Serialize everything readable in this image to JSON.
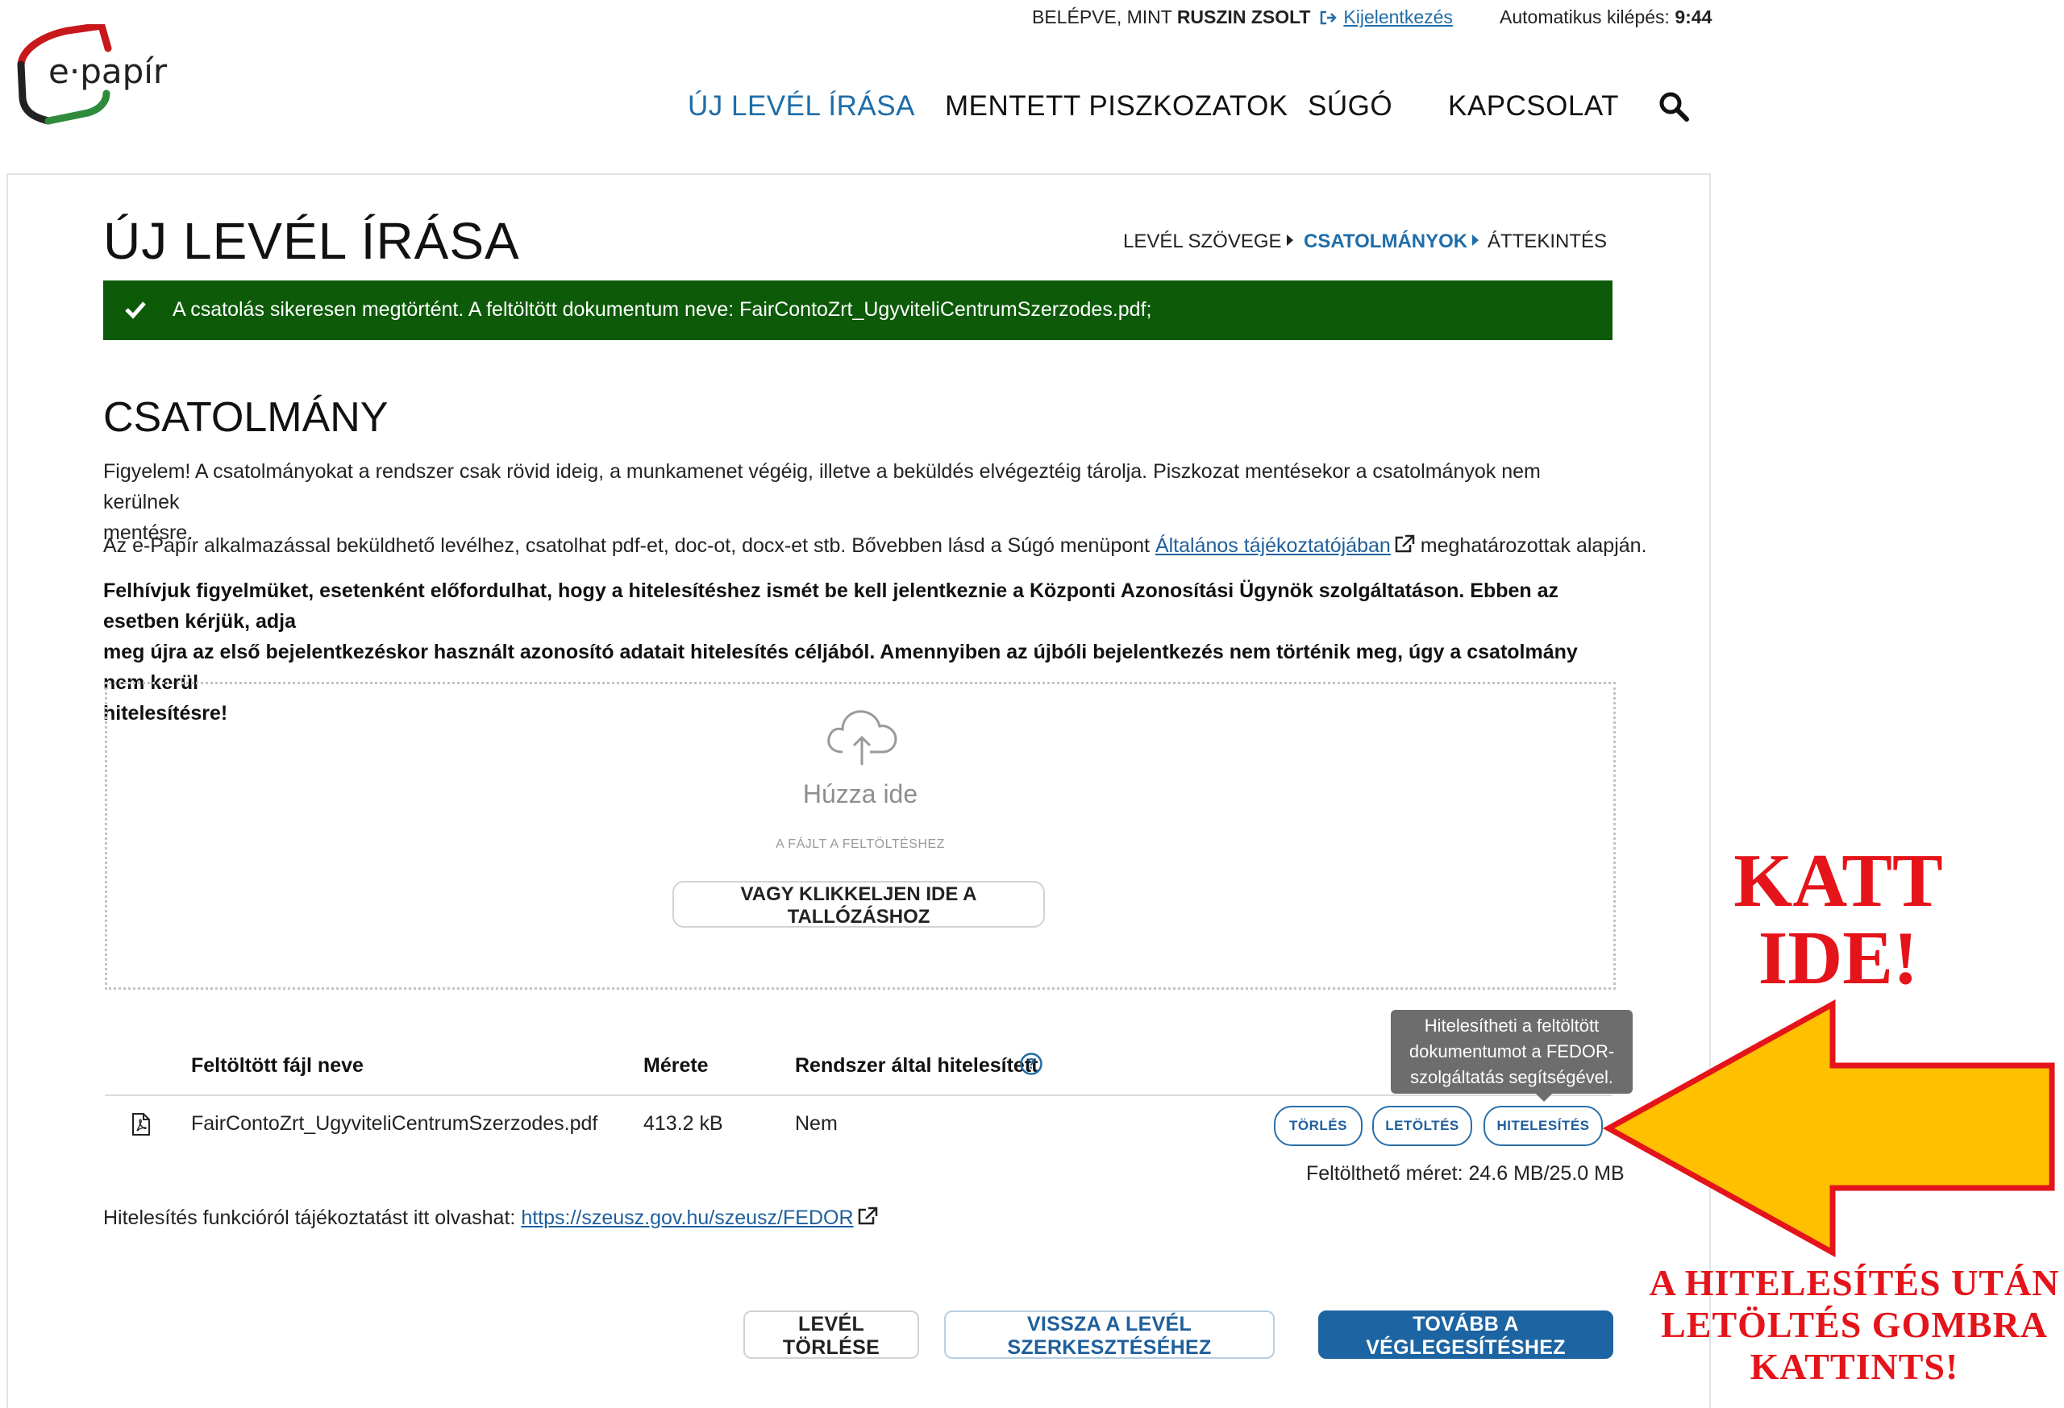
{
  "header": {
    "logged_in_prefix": "BELÉPVE, MINT",
    "user_name": "RUSZIN ZSOLT",
    "logout_label": "Kijelentkezés",
    "auto_logout_label": "Automatikus kilépés:",
    "auto_logout_time": "9:44",
    "logo_text": "e·papír",
    "nav": [
      "ÚJ LEVÉL ÍRÁSA",
      "MENTETT PISZKOZATOK",
      "SÚGÓ",
      "KAPCSOLAT"
    ],
    "search_icon": "search-icon"
  },
  "page": {
    "title": "ÚJ LEVÉL ÍRÁSA",
    "steps": [
      "LEVÉL SZÖVEGE",
      "CSATOLMÁNYOK",
      "ÁTTEKINTÉS"
    ],
    "active_step": "CSATOLMÁNYOK",
    "success_message": "A csatolás sikeresen megtörtént. A feltöltött dokumentum neve: FairContoZrt_UgyviteliCentrumSzerzodes.pdf;"
  },
  "attachment": {
    "section_title": "CSATOLMÁNY",
    "warning_line1": "Figyelem! A csatolmányokat a rendszer csak rövid ideig, a munkamenet végéig, illetve a beküldés elvégeztéig tárolja. Piszkozat mentésekor a csatolmányok nem kerülnek",
    "warning_line2": "mentésre.",
    "info_before_link": "Az e-Papír alkalmazással beküldhető levélhez, csatolhat pdf-et, doc-ot, docx-et stb. Bővebben lásd a Súgó menüpont",
    "info_link": "Általános tájékoztatójában",
    "info_after_link": "meghatározottak alapján.",
    "bold_line1": "Felhívjuk figyelmüket, esetenként előfordulhat, hogy a hitelesítéshez ismét be kell jelentkeznie a Központi Azonosítási Ügynök szolgáltatáson. Ebben az esetben kérjük, adja",
    "bold_line2": "meg újra az első bejelentkezéskor használt azonosító adatait hitelesítés céljából. Amennyiben az újbóli bejelentkezés nem történik meg, úgy a csatolmány nem kerül",
    "bold_line3": "hitelesítésre!",
    "dropzone": {
      "main": "Húzza ide",
      "sub": "A FÁJLT A FELTÖLTÉSHEZ",
      "browse_button": "VAGY KLIKKELJEN IDE A TALLÓZÁSHOZ"
    },
    "table": {
      "columns": [
        "Feltöltött fájl neve",
        "Mérete",
        "Rendszer által hitelesített"
      ],
      "rows": [
        {
          "name": "FairContoZrt_UgyviteliCentrumSzerzodes.pdf",
          "size": "413.2 kB",
          "authenticated": "Nem"
        }
      ],
      "actions": [
        "TÖRLÉS",
        "LETÖLTÉS",
        "HITELESÍTÉS"
      ],
      "tooltip_line1": "Hitelesítheti a feltöltött",
      "tooltip_line2": "dokumentumot a FEDOR-",
      "tooltip_line3": "szolgáltatás segítségével."
    },
    "uploadable_size": "Feltölthető méret: 24.6 MB/25.0 MB",
    "fedor_info": "Hitelesítés funkcióról tájékoztatást itt olvashat:",
    "fedor_link": "https://szeusz.gov.hu/szeusz/FEDOR"
  },
  "footer_buttons": {
    "delete": "LEVÉL TÖRLÉSE",
    "back": "VISSZA A LEVÉL SZERKESZTÉSÉHEZ",
    "next": "TOVÁBB A VÉGLEGESÍTÉSHEZ"
  },
  "annotation": {
    "katt_line1": "KATT",
    "katt_line2": "IDE!",
    "note_line1": "A HITELESÍTÉS UTÁN",
    "note_line2": "LETÖLTÉS GOMBRA",
    "note_line3": "KATTINTS!"
  },
  "colors": {
    "brand_blue": "#1f6da8",
    "success_green": "#0d5a08",
    "annotation_red": "#e4141a",
    "arrow_yellow": "#ffc000"
  }
}
